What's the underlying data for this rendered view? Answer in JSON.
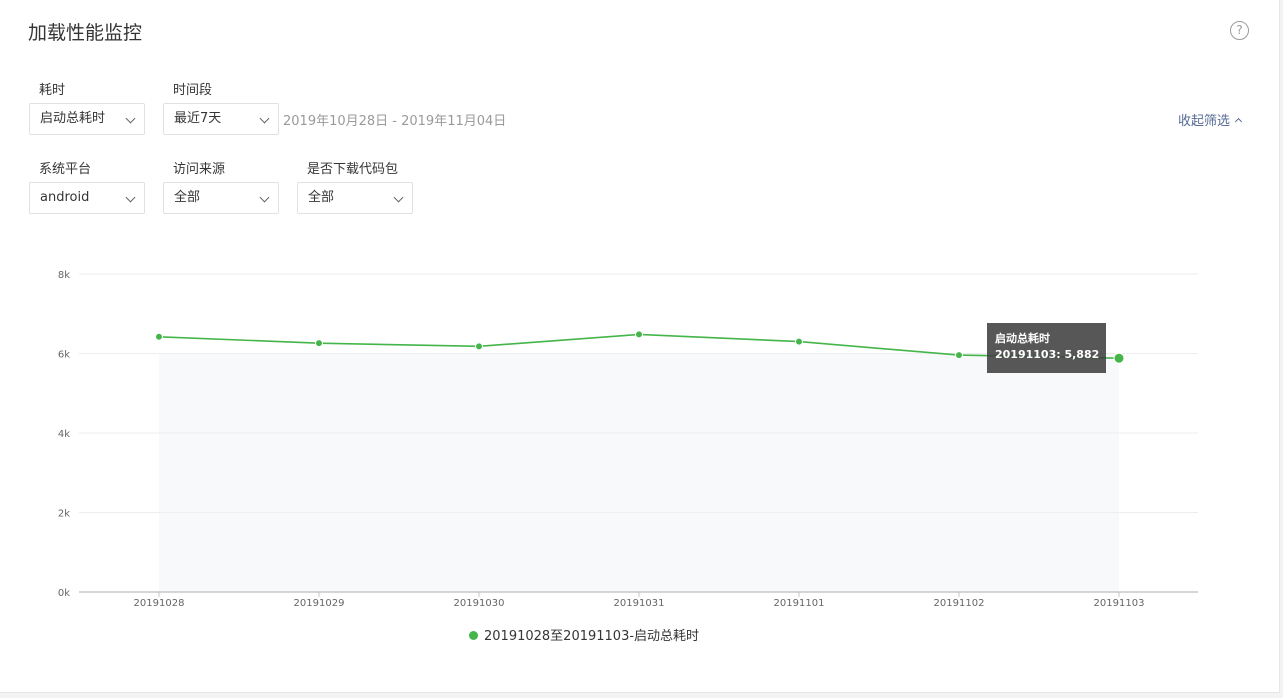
{
  "header": {
    "title": "加载性能监控",
    "help_icon": "?"
  },
  "filters": {
    "duration": {
      "label": "耗时",
      "value": "启动总耗时"
    },
    "period": {
      "label": "时间段",
      "value": "最近7天",
      "range": "2019年10月28日 - 2019年11月04日"
    },
    "collapse": {
      "label": "收起筛选"
    },
    "platform": {
      "label": "系统平台",
      "value": "android"
    },
    "source": {
      "label": "访问来源",
      "value": "全部"
    },
    "package": {
      "label": "是否下载代码包",
      "value": "全部"
    }
  },
  "chart_data": {
    "type": "line",
    "categories": [
      "20191028",
      "20191029",
      "20191030",
      "20191031",
      "20191101",
      "20191102",
      "20191103"
    ],
    "series": [
      {
        "name": "20191028至20191103-启动总耗时",
        "values": [
          6420,
          6260,
          6180,
          6480,
          6300,
          5960,
          5882
        ],
        "color": "#44b549"
      }
    ],
    "ylim": [
      0,
      8000
    ],
    "yticks": [
      "0k",
      "2k",
      "4k",
      "6k",
      "8k"
    ],
    "grid": true,
    "legend": "bottom",
    "tooltip": {
      "title": "启动总耗时",
      "text": "20191103: 5,882"
    }
  }
}
